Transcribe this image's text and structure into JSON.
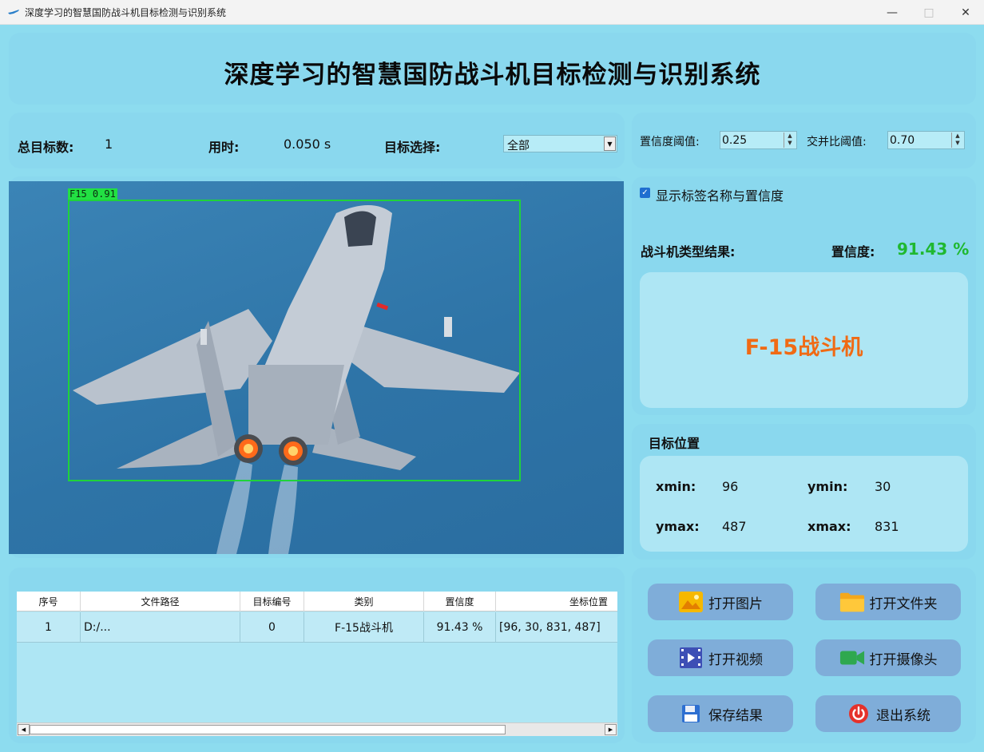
{
  "window": {
    "title": "深度学习的智慧国防战斗机目标检测与识别系统"
  },
  "header": {
    "title": "深度学习的智慧国防战斗机目标检测与识别系统"
  },
  "stats": {
    "total_label": "总目标数:",
    "total_value": "1",
    "time_label": "用时:",
    "time_value": "0.050 s",
    "select_label": "目标选择:",
    "select_value": "全部"
  },
  "thresholds": {
    "conf_label": "置信度阈值:",
    "conf_value": "0.25",
    "iou_label": "交并比阈值:",
    "iou_value": "0.70"
  },
  "image": {
    "bbox_label": "F15  0.91"
  },
  "result": {
    "show_label_text": "显示标签名称与置信度",
    "show_label_checked": true,
    "type_label": "战斗机类型结果:",
    "conf_label": "置信度:",
    "conf_value": "91.43 %",
    "type_value": "F-15战斗机"
  },
  "position": {
    "title": "目标位置",
    "xmin_label": "xmin:",
    "xmin": "96",
    "ymin_label": "ymin:",
    "ymin": "30",
    "ymax_label": "ymax:",
    "ymax": "487",
    "xmax_label": "xmax:",
    "xmax": "831"
  },
  "table": {
    "columns": [
      "序号",
      "文件路径",
      "目标编号",
      "类别",
      "置信度",
      "坐标位置"
    ],
    "rows": [
      [
        "1",
        "D:/...",
        "0",
        "F-15战斗机",
        "91.43 %",
        "[96, 30, 831, 487]"
      ]
    ]
  },
  "actions": {
    "open_image": "打开图片",
    "open_folder": "打开文件夹",
    "open_video": "打开视频",
    "open_camera": "打开摄像头",
    "save_result": "保存结果",
    "exit_system": "退出系统"
  },
  "colors": {
    "background": "#8ddcef",
    "accent_green": "#1fb830",
    "result_orange": "#f06a14",
    "button_blue": "#7fadd9",
    "bbox_green": "#1fd33a"
  }
}
